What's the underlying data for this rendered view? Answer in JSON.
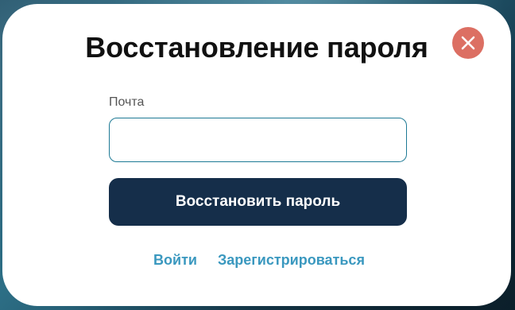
{
  "modal": {
    "title": "Восстановление пароля",
    "close_icon": "close-icon",
    "accent_close_color": "#dc6f63"
  },
  "form": {
    "email_label": "Почта",
    "email_value": "",
    "email_placeholder": "",
    "submit_label": "Восстановить пароль",
    "submit_color": "#152e4a"
  },
  "links": {
    "login_label": "Войти",
    "register_label": "Зарегистрироваться",
    "link_color": "#3a98bf"
  }
}
